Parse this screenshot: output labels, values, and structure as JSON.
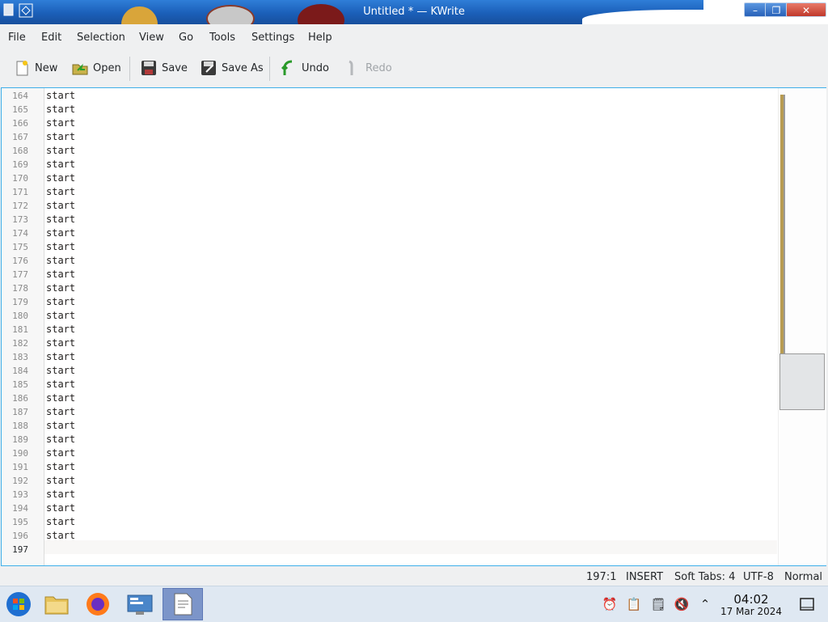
{
  "window": {
    "title": "Untitled * — KWrite"
  },
  "menu": [
    "File",
    "Edit",
    "Selection",
    "View",
    "Go",
    "Tools",
    "Settings",
    "Help"
  ],
  "toolbar": {
    "new_label": "New",
    "open_label": "Open",
    "save_label": "Save",
    "save_as_label": "Save As",
    "undo_label": "Undo",
    "redo_label": "Redo"
  },
  "editor": {
    "line_numbers": [
      "164",
      "165",
      "166",
      "167",
      "168",
      "169",
      "170",
      "171",
      "172",
      "173",
      "174",
      "175",
      "176",
      "177",
      "178",
      "179",
      "180",
      "181",
      "182",
      "183",
      "184",
      "185",
      "186",
      "187",
      "188",
      "189",
      "190",
      "191",
      "192",
      "193",
      "194",
      "195",
      "196",
      "197"
    ],
    "lines": [
      "start",
      "start",
      "start",
      "start",
      "start",
      "start",
      "start",
      "start",
      "start",
      "start",
      "start",
      "start",
      "start",
      "start",
      "start",
      "start",
      "start",
      "start",
      "start",
      "start",
      "start",
      "start",
      "start",
      "start",
      "start",
      "start",
      "start",
      "start",
      "start",
      "start",
      "start",
      "start",
      "start",
      ""
    ],
    "current_line": "197"
  },
  "status": {
    "cursor": "197:1",
    "mode": "INSERT",
    "tabs": "Soft Tabs: 4",
    "encoding": "UTF-8",
    "input_mode": "Normal"
  },
  "clock": {
    "time": "04:02",
    "date": "17 Mar 2024"
  },
  "taskbar": {
    "apps": [
      "start-menu-icon",
      "file-manager-icon",
      "firefox-icon",
      "system-settings-icon",
      "kwrite-icon"
    ],
    "tray": [
      "alarm-icon",
      "clipboard-icon",
      "notes-icon",
      "mute-icon",
      "chevron-up-icon"
    ]
  }
}
